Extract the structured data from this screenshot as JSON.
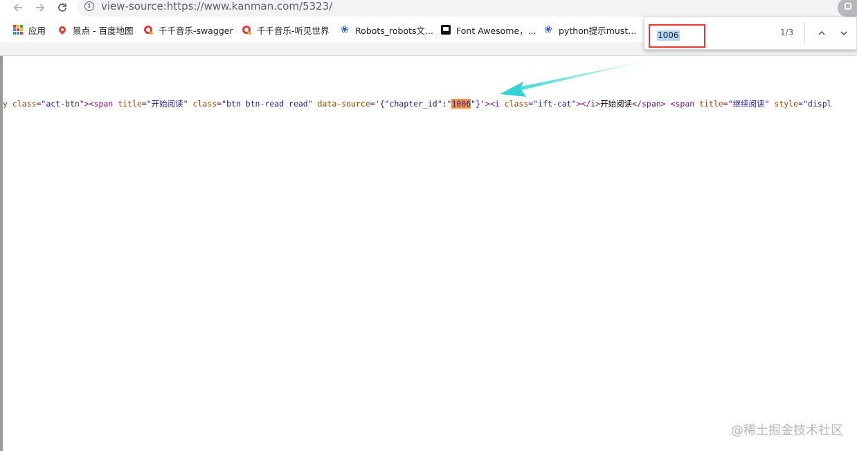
{
  "toolbar": {
    "url": "view-source:https://www.kanman.com/5323/",
    "info_glyph": "i"
  },
  "bookmarks": [
    {
      "label": "应用",
      "icon": "apps-grid-icon"
    },
    {
      "label": "景点 - 百度地图",
      "icon": "map-pin-icon"
    },
    {
      "label": "千千音乐-swagger",
      "icon": "qianqian-music-icon"
    },
    {
      "label": "千千音乐-听见世界",
      "icon": "qianqian-music-icon"
    },
    {
      "label": "Robots_robots文...",
      "icon": "baidu-paw-icon"
    },
    {
      "label": "Font Awesome，...",
      "icon": "font-awesome-flag-icon"
    },
    {
      "label": "python提示must...",
      "icon": "baidu-paw-icon"
    }
  ],
  "source_line": [
    {
      "cls": "t-attr",
      "text": "y class"
    },
    {
      "cls": "t-tag",
      "text": "="
    },
    {
      "cls": "t-val",
      "text": "\"act-btn\""
    },
    {
      "cls": "t-tag",
      "text": "><span "
    },
    {
      "cls": "t-attr",
      "text": "title"
    },
    {
      "cls": "t-tag",
      "text": "="
    },
    {
      "cls": "t-val",
      "text": "\"开始阅读\" "
    },
    {
      "cls": "t-attr",
      "text": "class"
    },
    {
      "cls": "t-tag",
      "text": "="
    },
    {
      "cls": "t-val",
      "text": "\"btn btn-read read\" "
    },
    {
      "cls": "t-attr",
      "text": "data-source"
    },
    {
      "cls": "t-tag",
      "text": "="
    },
    {
      "cls": "t-val",
      "text": "'{\"chapter_id\":\""
    },
    {
      "cls": "hl",
      "text": "1006"
    },
    {
      "cls": "t-val",
      "text": "\"}'"
    },
    {
      "cls": "t-tag",
      "text": "><i "
    },
    {
      "cls": "t-attr",
      "text": "class"
    },
    {
      "cls": "t-tag",
      "text": "="
    },
    {
      "cls": "t-val",
      "text": "\"ift-cat\""
    },
    {
      "cls": "t-tag",
      "text": "></i>"
    },
    {
      "cls": "t-text",
      "text": "开始阅读"
    },
    {
      "cls": "t-tag",
      "text": "</span> <span "
    },
    {
      "cls": "t-attr",
      "text": "title"
    },
    {
      "cls": "t-tag",
      "text": "="
    },
    {
      "cls": "t-val",
      "text": "\"继续阅读\" "
    },
    {
      "cls": "t-attr",
      "text": "style"
    },
    {
      "cls": "t-tag",
      "text": "="
    },
    {
      "cls": "t-val",
      "text": "\"displ"
    }
  ],
  "find": {
    "query": "1006",
    "count": "1/3"
  },
  "watermark": "@稀土掘金技术社区",
  "colors": {
    "highlight": "#ff9632",
    "find_box_border": "#e53935",
    "arrow": "#34d3d6",
    "tag": "#881280",
    "attr": "#994500",
    "value": "#1a1aa6"
  }
}
